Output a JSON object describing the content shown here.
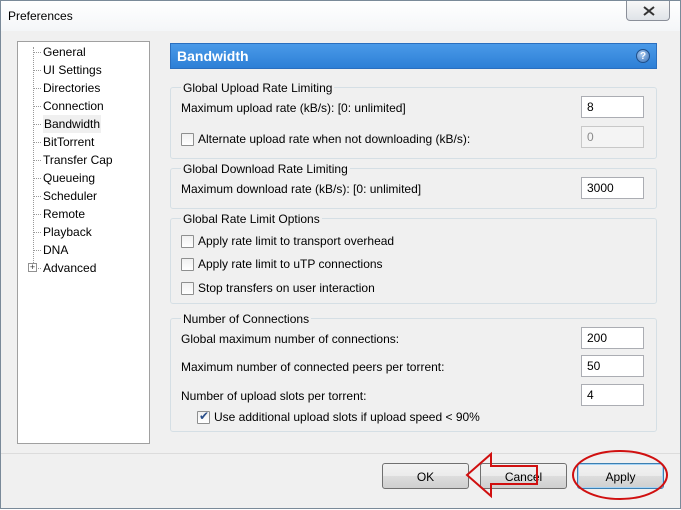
{
  "window": {
    "title": "Preferences"
  },
  "sidebar": {
    "items": [
      {
        "label": "General"
      },
      {
        "label": "UI Settings"
      },
      {
        "label": "Directories"
      },
      {
        "label": "Connection"
      },
      {
        "label": "Bandwidth",
        "selected": true
      },
      {
        "label": "BitTorrent"
      },
      {
        "label": "Transfer Cap"
      },
      {
        "label": "Queueing"
      },
      {
        "label": "Scheduler"
      },
      {
        "label": "Remote"
      },
      {
        "label": "Playback"
      },
      {
        "label": "DNA"
      },
      {
        "label": "Advanced",
        "expandable": true
      }
    ]
  },
  "panel": {
    "title": "Bandwidth",
    "help_icon": "?",
    "upload_group": {
      "title": "Global Upload Rate Limiting",
      "max_upload_label": "Maximum upload rate (kB/s): [0: unlimited]",
      "max_upload_value": "8",
      "alt_upload_label": "Alternate upload rate when not downloading (kB/s):",
      "alt_upload_checked": false,
      "alt_upload_value": "0"
    },
    "download_group": {
      "title": "Global Download Rate Limiting",
      "max_download_label": "Maximum download rate (kB/s): [0: unlimited]",
      "max_download_value": "3000"
    },
    "options_group": {
      "title": "Global Rate Limit Options",
      "transport_overhead_label": "Apply rate limit to transport overhead",
      "transport_overhead_checked": false,
      "utp_label": "Apply rate limit to uTP connections",
      "utp_checked": false,
      "stop_transfers_label": "Stop transfers on user interaction",
      "stop_transfers_checked": false
    },
    "connections_group": {
      "title": "Number of Connections",
      "global_max_label": "Global maximum number of connections:",
      "global_max_value": "200",
      "peers_label": "Maximum number of connected peers per torrent:",
      "peers_value": "50",
      "upload_slots_label": "Number of upload slots per torrent:",
      "upload_slots_value": "4",
      "additional_slots_label": "Use additional upload slots if upload speed < 90%",
      "additional_slots_checked": true
    }
  },
  "footer": {
    "ok_label": "OK",
    "cancel_label": "Cancel",
    "apply_label": "Apply"
  },
  "colors": {
    "header_blue": "#2d7fd6",
    "annotation_red": "#d01010"
  }
}
